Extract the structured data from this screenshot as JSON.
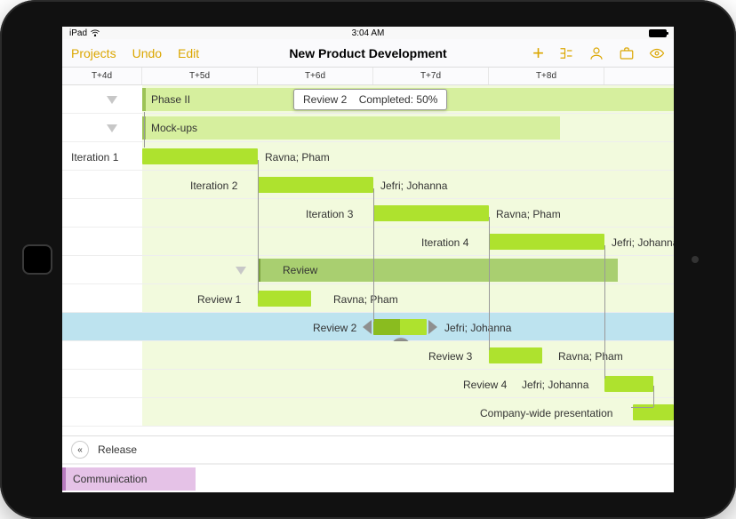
{
  "status": {
    "device": "iPad",
    "time": "3:04 AM"
  },
  "toolbar": {
    "projects": "Projects",
    "undo": "Undo",
    "edit": "Edit",
    "title": "New Product Development"
  },
  "timeline": {
    "days": [
      "T+4d",
      "T+5d",
      "T+6d",
      "T+7d",
      "T+8d"
    ]
  },
  "tooltip": {
    "task": "Review 2",
    "completed_label": "Completed:",
    "completed_value": "50%"
  },
  "rows": {
    "phase": "Phase II",
    "mockups": "Mock-ups",
    "iter1": {
      "name": "Iteration 1",
      "assignees": "Ravna; Pham"
    },
    "iter2": {
      "name": "Iteration 2",
      "assignees": "Jefri; Johanna"
    },
    "iter3": {
      "name": "Iteration 3",
      "assignees": "Ravna; Pham"
    },
    "iter4": {
      "name": "Iteration 4",
      "assignees": "Jefri; Johanna"
    },
    "reviewGroup": "Review",
    "rev1": {
      "name": "Review 1",
      "assignees": "Ravna; Pham"
    },
    "rev2": {
      "name": "Review 2",
      "assignees": "Jefri; Johanna"
    },
    "rev3": {
      "name": "Review 3",
      "assignees": "Ravna; Pham"
    },
    "rev4": {
      "name": "Review 4",
      "assignees": "Jefri; Johanna"
    },
    "presentation": "Company-wide presentation",
    "release": "Release",
    "communication": "Communication"
  },
  "chart_data": {
    "type": "gantt",
    "timescale": {
      "unit": "day",
      "start": 4,
      "end": 9
    },
    "selected": "rev2",
    "tasks": [
      {
        "id": "phase2",
        "name": "Phase II",
        "kind": "group",
        "start": 4.0,
        "end": 9.0
      },
      {
        "id": "mockups",
        "name": "Mock-ups",
        "kind": "group",
        "start": 4.0,
        "end": 8.0,
        "parent": "phase2"
      },
      {
        "id": "i1",
        "name": "Iteration 1",
        "kind": "task",
        "start": 4.0,
        "end": 5.0,
        "assignees": "Ravna; Pham",
        "parent": "mockups"
      },
      {
        "id": "i2",
        "name": "Iteration 2",
        "kind": "task",
        "start": 5.0,
        "end": 6.0,
        "assignees": "Jefri; Johanna",
        "parent": "mockups",
        "depends_on": "i1"
      },
      {
        "id": "i3",
        "name": "Iteration 3",
        "kind": "task",
        "start": 6.0,
        "end": 7.0,
        "assignees": "Ravna; Pham",
        "parent": "mockups",
        "depends_on": "i2"
      },
      {
        "id": "i4",
        "name": "Iteration 4",
        "kind": "task",
        "start": 7.0,
        "end": 8.0,
        "assignees": "Jefri; Johanna",
        "parent": "mockups",
        "depends_on": "i3"
      },
      {
        "id": "review",
        "name": "Review",
        "kind": "group",
        "start": 5.0,
        "end": 8.5,
        "parent": "phase2"
      },
      {
        "id": "r1",
        "name": "Review 1",
        "kind": "task",
        "start": 5.0,
        "end": 5.5,
        "assignees": "Ravna; Pham",
        "parent": "review",
        "depends_on": "i1"
      },
      {
        "id": "r2",
        "name": "Review 2",
        "kind": "task",
        "start": 6.0,
        "end": 6.5,
        "assignees": "Jefri; Johanna",
        "parent": "review",
        "depends_on": "i2",
        "progress": 0.5
      },
      {
        "id": "r3",
        "name": "Review 3",
        "kind": "task",
        "start": 7.0,
        "end": 7.5,
        "assignees": "Ravna; Pham",
        "parent": "review",
        "depends_on": "i3"
      },
      {
        "id": "r4",
        "name": "Review 4",
        "kind": "task",
        "start": 8.0,
        "end": 8.5,
        "assignees": "Jefri; Johanna",
        "parent": "review",
        "depends_on": "i4"
      },
      {
        "id": "pres",
        "name": "Company-wide presentation",
        "kind": "task",
        "start": 8.6,
        "end": 9.0,
        "parent": "phase2",
        "depends_on": "r4"
      },
      {
        "id": "release",
        "name": "Release",
        "kind": "group-collapsed"
      },
      {
        "id": "comm",
        "name": "Communication",
        "kind": "group-other",
        "end": 5.0
      }
    ]
  }
}
